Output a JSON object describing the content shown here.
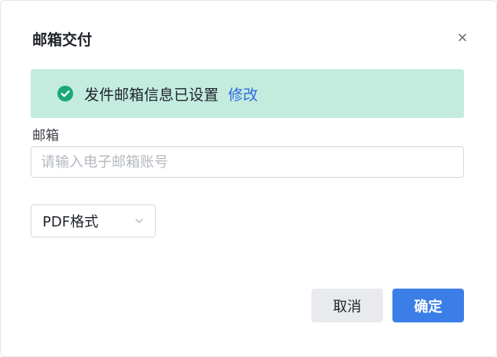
{
  "dialog": {
    "title": "邮箱交付",
    "close_symbol": "×"
  },
  "notice": {
    "icon": "check-circle-icon",
    "text": "发件邮箱信息已设置",
    "link_label": "修改",
    "colors": {
      "background": "#c3ecdf",
      "icon": "#1aa874",
      "link": "#2f6ce0"
    }
  },
  "email": {
    "label": "邮箱",
    "value": "",
    "placeholder": "请输入电子邮箱账号"
  },
  "format_select": {
    "selected": "PDF格式"
  },
  "footer": {
    "cancel_label": "取消",
    "confirm_label": "确定",
    "colors": {
      "confirm": "#3b7ee8",
      "cancel": "#e8eaed"
    }
  }
}
